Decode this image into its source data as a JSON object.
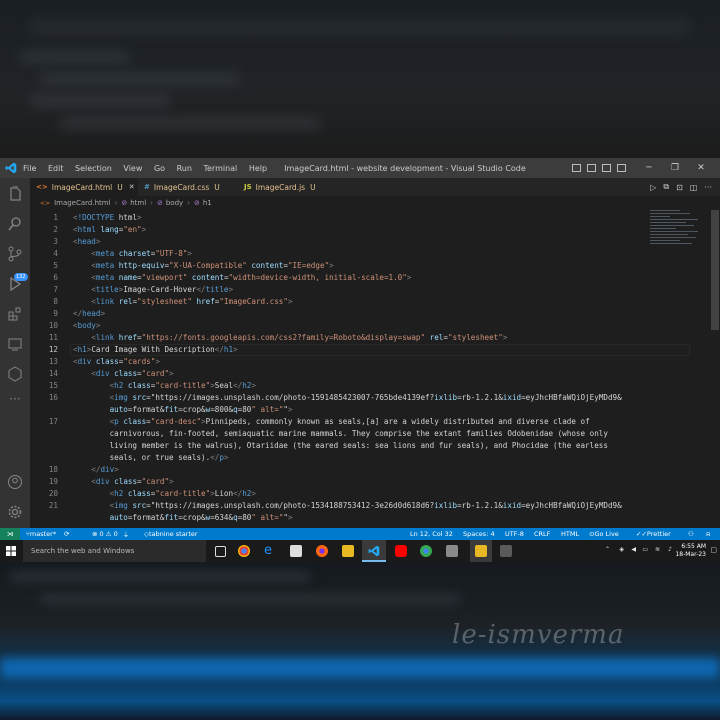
{
  "titlebar": {
    "menu": [
      "File",
      "Edit",
      "Selection",
      "View",
      "Go",
      "Run",
      "Terminal",
      "Help"
    ],
    "window_title": "ImageCard.html - website development - Visual Studio Code"
  },
  "tabs": [
    {
      "label": "ImageCard.html",
      "status": "U",
      "icon": "<>",
      "color": "#e37933"
    },
    {
      "label": "ImageCard.css",
      "status": "U",
      "icon": "#",
      "color": "#519aba"
    },
    {
      "label": "ImageCard.js",
      "status": "U",
      "icon": "JS",
      "color": "#cbcb41"
    }
  ],
  "breadcrumb": [
    "ImageCard.html",
    "html",
    "body",
    "h1"
  ],
  "activity_badge": "132",
  "lines": [
    {
      "n": "1",
      "code": "<!DOCTYPE html>"
    },
    {
      "n": "2",
      "code": "<html lang=\"en\">"
    },
    {
      "n": "3",
      "code": "<head>"
    },
    {
      "n": "4",
      "code": "    <meta charset=\"UTF-8\">"
    },
    {
      "n": "5",
      "code": "    <meta http-equiv=\"X-UA-Compatible\" content=\"IE=edge\">"
    },
    {
      "n": "6",
      "code": "    <meta name=\"viewport\" content=\"width=device-width, initial-scale=1.0\">"
    },
    {
      "n": "7",
      "code": "    <title>Image-Card-Hover</title>"
    },
    {
      "n": "8",
      "code": "    <link rel=\"stylesheet\" href=\"ImageCard.css\">"
    },
    {
      "n": "9",
      "code": "</head>"
    },
    {
      "n": "10",
      "code": "<body>"
    },
    {
      "n": "11",
      "code": "    <link href=\"https://fonts.googleapis.com/css2?family=Roboto&display=swap\" rel=\"stylesheet\">"
    },
    {
      "n": "12",
      "code": "<h1>Card Image With Description</h1>"
    },
    {
      "n": "13",
      "code": "<div class=\"cards\">"
    },
    {
      "n": "14",
      "code": "    <div class=\"card\">"
    },
    {
      "n": "15",
      "code": "        <h2 class=\"card-title\">Seal</h2>"
    },
    {
      "n": "16",
      "code": "        <img src=\"https://images.unsplash.com/photo-1591485423007-765bde4139ef?ixlib=rb-1.2.1&ixid=eyJhcHBfaWQiOjEyMDd9&"
    },
    {
      "n": "",
      "code": "        auto=format&fit=crop&w=800&q=80\" alt=\"\">"
    },
    {
      "n": "17",
      "code": "        <p class=\"card-desc\">Pinnipeds, commonly known as seals,[a] are a widely distributed and diverse clade of"
    },
    {
      "n": "",
      "code": "        carnivorous, fin-footed, semiaquatic marine mammals. They comprise the extant families Odobenidae (whose only"
    },
    {
      "n": "",
      "code": "        living member is the walrus), Otariidae (the eared seals: sea lions and fur seals), and Phocidae (the earless"
    },
    {
      "n": "",
      "code": "        seals, or true seals).</p>"
    },
    {
      "n": "18",
      "code": "    </div>"
    },
    {
      "n": "19",
      "code": "    <div class=\"card\">"
    },
    {
      "n": "20",
      "code": "        <h2 class=\"card-title\">Lion</h2>"
    },
    {
      "n": "21",
      "code": "        <img src=\"https://images.unsplash.com/photo-1534188753412-3e26d0d618d6?ixlib=rb-1.2.1&ixid=eyJhcHBfaWQiOjEyMDd9&"
    },
    {
      "n": "",
      "code": "        auto=format&fit=crop&w=634&q=80\" alt=\"\">"
    }
  ],
  "status": {
    "branch": "master*",
    "problems": "⊗ 0 ⚠ 0",
    "tabnine": "tabnine starter",
    "position": "Ln 12, Col 32",
    "spaces": "Spaces: 4",
    "encoding": "UTF-8",
    "eol": "CRLF",
    "language": "HTML",
    "golive": "Go Live",
    "prettier": "Prettier"
  },
  "taskbar": {
    "search_placeholder": "Search the web and Windows",
    "time": "6:55 AM",
    "date": "18-Mar-23"
  },
  "watermark": "le-ismverma"
}
